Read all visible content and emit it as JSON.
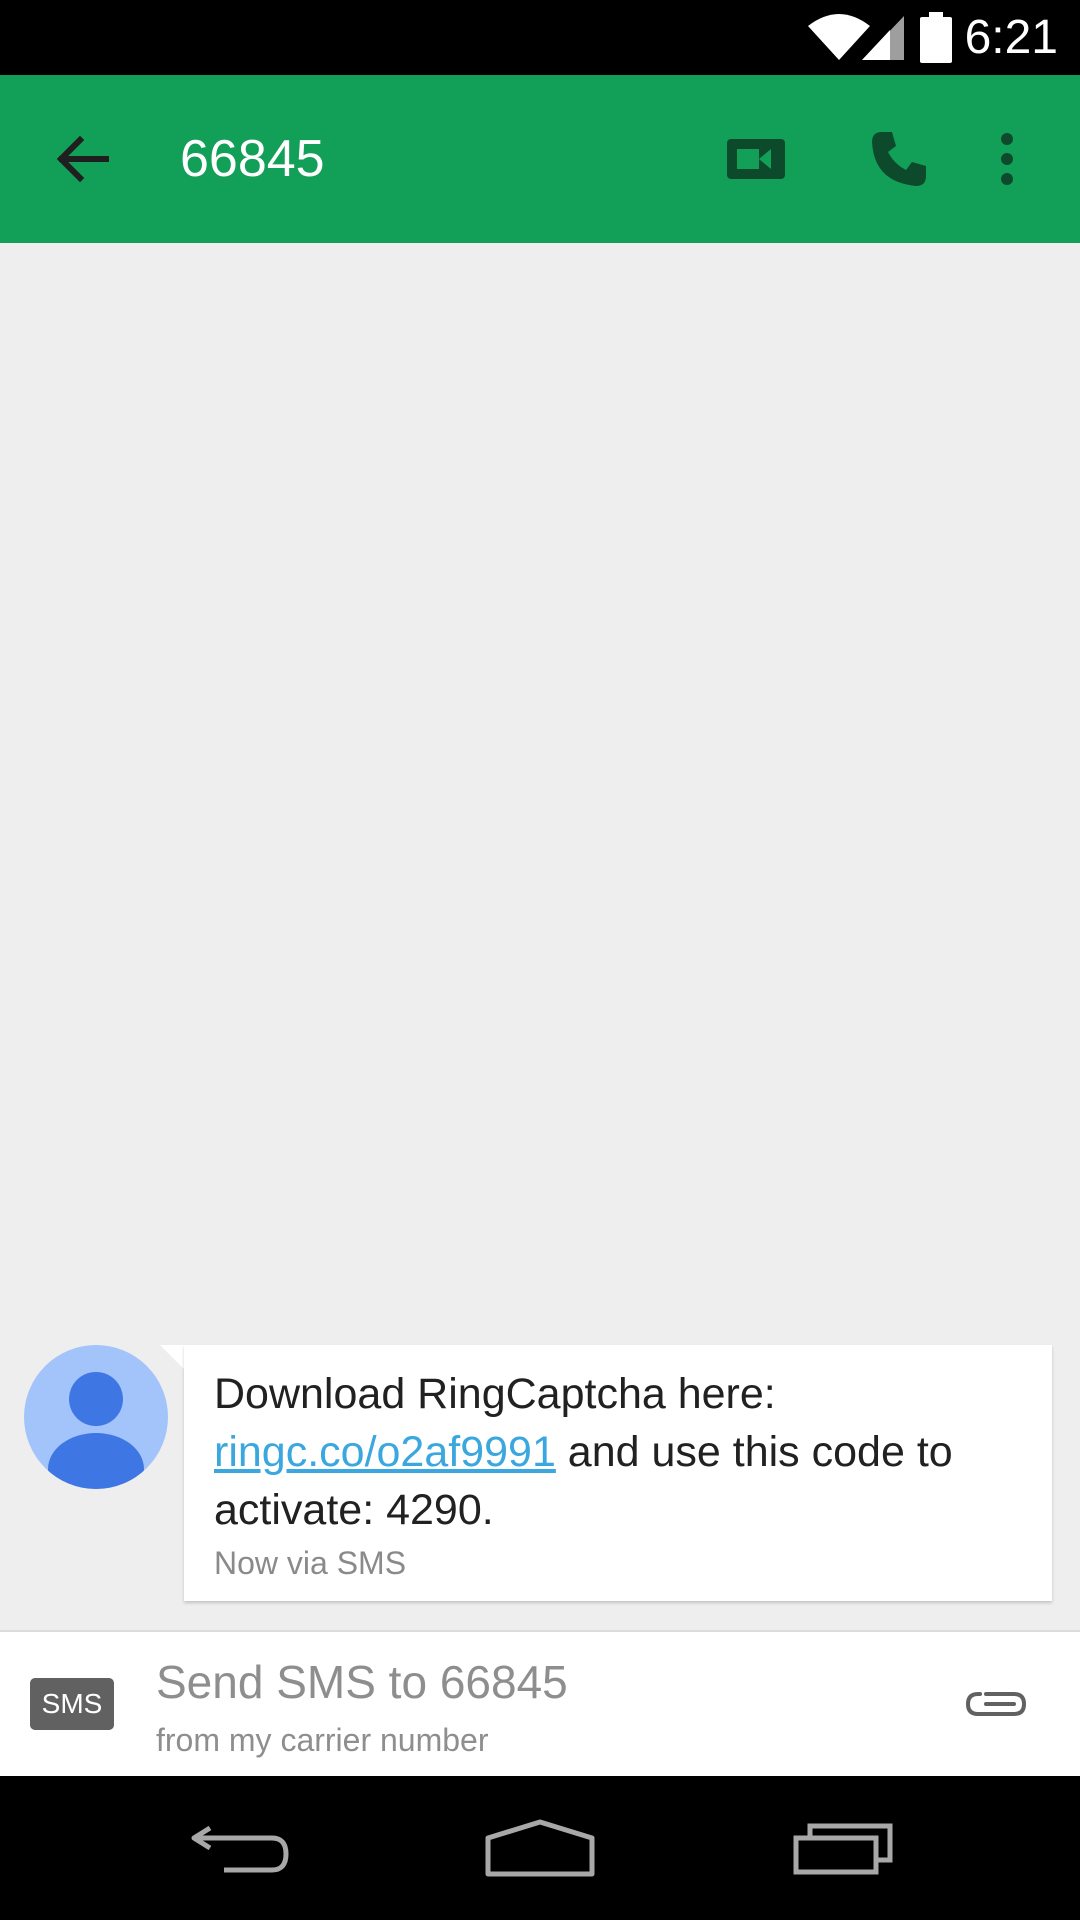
{
  "status_bar": {
    "time": "6:21",
    "icons": [
      "wifi-icon",
      "cell-signal-icon",
      "battery-icon"
    ]
  },
  "toolbar": {
    "title": "66845",
    "background_color": "#12a058",
    "icons": [
      "back-arrow-icon",
      "video-call-icon",
      "phone-icon",
      "more-vert-icon"
    ]
  },
  "thread": {
    "messages": [
      {
        "avatar_icon": "person-icon",
        "text_before_link": "Download RingCaptcha here: ",
        "link": "ringc.co/o2af9991",
        "text_after_link": " and use this code to activate: 4290.",
        "meta": "Now via SMS"
      }
    ]
  },
  "compose": {
    "badge": "SMS",
    "placeholder": "Send SMS to 66845",
    "subtext": "from my carrier number",
    "attach_icon": "paperclip-icon"
  },
  "nav_bar": {
    "icons": [
      "back-icon",
      "home-icon",
      "recents-icon"
    ]
  }
}
